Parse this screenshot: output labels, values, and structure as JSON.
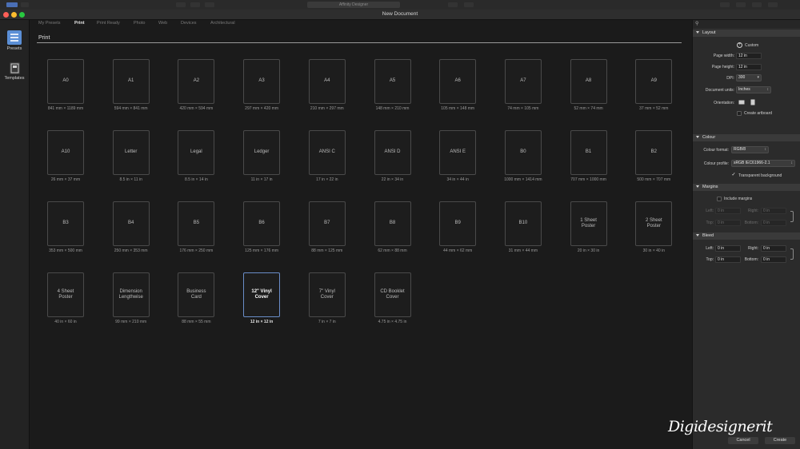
{
  "window": {
    "app_title": "Affinity Designer",
    "title": "New Document"
  },
  "sidebar": {
    "items": [
      {
        "label": "Presets"
      },
      {
        "label": "Templates"
      }
    ]
  },
  "tabs": [
    "My Presets",
    "Print",
    "Print Ready",
    "Photo",
    "Web",
    "Devices",
    "Architectural"
  ],
  "active_tab": "Print",
  "section_title": "Print",
  "presets": [
    {
      "name": "A0",
      "size": "841 mm × 1189 mm"
    },
    {
      "name": "A1",
      "size": "594 mm × 841 mm"
    },
    {
      "name": "A2",
      "size": "420 mm × 594 mm"
    },
    {
      "name": "A3",
      "size": "297 mm × 420 mm"
    },
    {
      "name": "A4",
      "size": "210 mm × 297 mm"
    },
    {
      "name": "A5",
      "size": "148 mm × 210 mm"
    },
    {
      "name": "A6",
      "size": "105 mm × 148 mm"
    },
    {
      "name": "A7",
      "size": "74 mm × 105 mm"
    },
    {
      "name": "A8",
      "size": "52 mm × 74 mm"
    },
    {
      "name": "A9",
      "size": "37 mm × 52 mm"
    },
    {
      "name": "A10",
      "size": "26 mm × 37 mm"
    },
    {
      "name": "Letter",
      "size": "8.5 in × 11 in"
    },
    {
      "name": "Legal",
      "size": "8.5 in × 14 in"
    },
    {
      "name": "Ledger",
      "size": "11 in × 17 in"
    },
    {
      "name": "ANSI C",
      "size": "17 in × 22 in"
    },
    {
      "name": "ANSI D",
      "size": "22 in × 34 in"
    },
    {
      "name": "ANSI E",
      "size": "34 in × 44 in"
    },
    {
      "name": "B0",
      "size": "1000 mm × 1414 mm"
    },
    {
      "name": "B1",
      "size": "707 mm × 1000 mm"
    },
    {
      "name": "B2",
      "size": "500 mm × 707 mm"
    },
    {
      "name": "B3",
      "size": "353 mm × 500 mm"
    },
    {
      "name": "B4",
      "size": "250 mm × 353 mm"
    },
    {
      "name": "B5",
      "size": "176 mm × 250 mm"
    },
    {
      "name": "B6",
      "size": "125 mm × 176 mm"
    },
    {
      "name": "B7",
      "size": "88 mm × 125 mm"
    },
    {
      "name": "B8",
      "size": "62 mm × 88 mm"
    },
    {
      "name": "B9",
      "size": "44 mm × 62 mm"
    },
    {
      "name": "B10",
      "size": "31 mm × 44 mm"
    },
    {
      "name": "1 Sheet\nPoster",
      "size": "20 in × 30 in"
    },
    {
      "name": "2 Sheet\nPoster",
      "size": "30 in × 40 in"
    },
    {
      "name": "4 Sheet\nPoster",
      "size": "40 in × 60 in"
    },
    {
      "name": "Dimension\nLengthwise",
      "size": "99 mm × 210 mm"
    },
    {
      "name": "Business\nCard",
      "size": "88 mm × 55 mm"
    },
    {
      "name": "12\" Vinyl\nCover",
      "size": "12 in × 12 in",
      "selected": true
    },
    {
      "name": "7\" Vinyl\nCover",
      "size": "7 in × 7 in"
    },
    {
      "name": "CD Booklet\nCover",
      "size": "4.75 in × 4.75 in"
    }
  ],
  "panel": {
    "layout": {
      "header": "Layout",
      "custom_label": "Custom",
      "page_width_label": "Page width:",
      "page_width": "12 in",
      "page_height_label": "Page height:",
      "page_height": "12 in",
      "dpi_label": "DPI:",
      "dpi": "300",
      "units_label": "Document units:",
      "units": "Inches",
      "orientation_label": "Orientation:",
      "create_artboard_label": "Create artboard",
      "create_artboard": false
    },
    "colour": {
      "header": "Colour",
      "format_label": "Colour format:",
      "format": "RGB/8",
      "profile_label": "Colour profile:",
      "profile": "sRGB IEC61966-2.1",
      "transparent_label": "Transparent background",
      "transparent": true
    },
    "margins": {
      "header": "Margins",
      "include_label": "Include margins",
      "left_label": "Left:",
      "left": "0 in",
      "right_label": "Right:",
      "right": "0 in",
      "top_label": "Top:",
      "top": "0 in",
      "bottom_label": "Bottom:",
      "bottom": "0 in"
    },
    "bleed": {
      "header": "Bleed",
      "left_label": "Left:",
      "left": "0 in",
      "right_label": "Right:",
      "right": "0 in",
      "top_label": "Top:",
      "top": "0 in",
      "bottom_label": "Bottom:",
      "bottom": "0 in"
    }
  },
  "buttons": {
    "cancel": "Cancel",
    "create": "Create"
  },
  "watermark": "Digidesignerit",
  "colors": {
    "accent_selected": "#6a8dc8",
    "traffic_close": "#ff5f57",
    "traffic_min": "#febc2e",
    "traffic_max": "#28c840",
    "sidebar_icon": "#5b8fd6"
  }
}
